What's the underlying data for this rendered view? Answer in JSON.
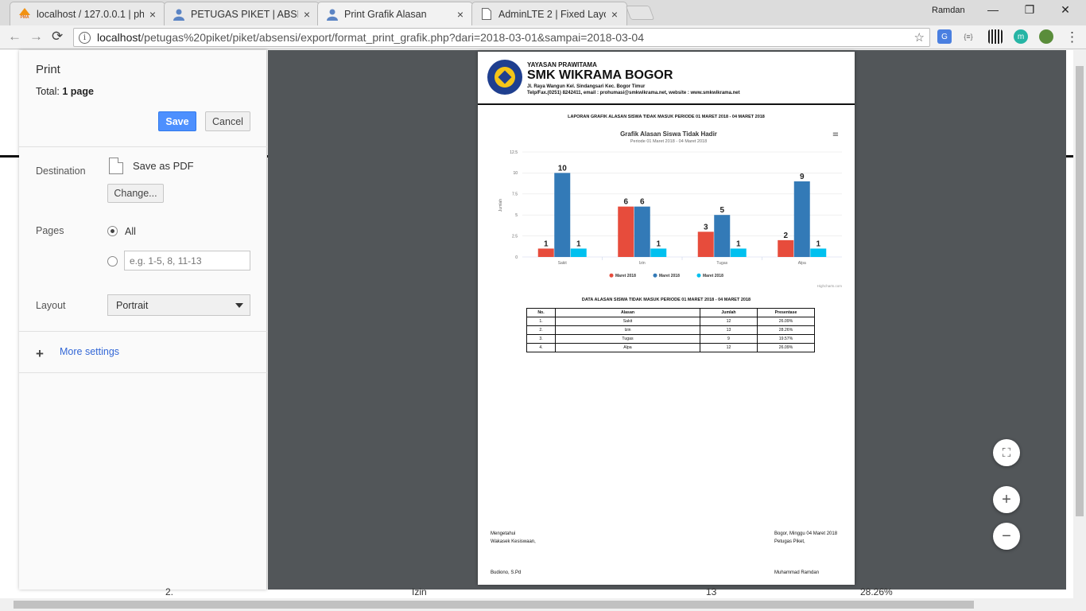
{
  "tabs": [
    {
      "title": "localhost / 127.0.0.1 | php",
      "favicon": "phpmyadmin-icon",
      "favicon_text": "PMA",
      "close": "×",
      "active": false
    },
    {
      "title": "PETUGAS PIKET | ABSENS",
      "favicon": "user-icon",
      "close": "×",
      "active": false
    },
    {
      "title": "Print Grafik Alasan",
      "favicon": "user-icon",
      "close": "×",
      "active": true
    },
    {
      "title": "AdminLTE 2 | Fixed Layou",
      "favicon": "page-icon",
      "close": "×",
      "active": false
    }
  ],
  "window": {
    "profile_name": "Ramdan",
    "minimize": "—",
    "restore": "❐",
    "close": "✕"
  },
  "address": {
    "host": "localhost",
    "path": "/petugas%20piket/piket/absensi/export/format_print_grafik.php?dari=2018-03-01&sampai=2018-03-04",
    "info_glyph": "i",
    "star_glyph": "☆"
  },
  "nav": {
    "back": "←",
    "forward": "→",
    "reload": "⟳",
    "menu": "⋮"
  },
  "extensions": {
    "json_viewer": "{≡}",
    "mercury": "m"
  },
  "print": {
    "title": "Print",
    "total_label": "Total:",
    "total_value": "1 page",
    "save_label": "Save",
    "cancel_label": "Cancel",
    "destination_label": "Destination",
    "destination_name": "Save as PDF",
    "change_label": "Change...",
    "pages_label": "Pages",
    "pages_all": "All",
    "pages_placeholder": "e.g. 1-5, 8, 11-13",
    "layout_label": "Layout",
    "layout_value": "Portrait",
    "more_settings_plus": "+",
    "more_settings": "More settings"
  },
  "zoom_controls": {
    "fit": "⛶",
    "zoom_in": "+",
    "zoom_out": "−"
  },
  "background_footer": {
    "col1": "2.",
    "col2": "Izin",
    "col3": "13",
    "col4": "28.26%"
  },
  "report": {
    "foundation": "YAYASAN PRAWITAMA",
    "school": "SMK WIKRAMA BOGOR",
    "address": "Jl. Raya Wangun Kel. Sindangsari Kec. Bogor Timur",
    "contact": "Telp/Fax.(0251) 8242411, email : prohumasi@smkwikrama.net, website : www.smkwikrama.net",
    "title": "LAPORAN GRAFIK ALASAN SISWA TIDAK MASUK PERIODE 01 MARET 2018 - 04 MARET 2018",
    "table_title": "DATA ALASAN SISWA TIDAK MASUK PERIODE 01 MARET 2018 - 04 MARET 2018",
    "table_headers": [
      "No.",
      "Alasan",
      "Jumlah",
      "Presentase"
    ],
    "table_rows": [
      [
        "1.",
        "Sakit",
        "12",
        "26.09%"
      ],
      [
        "2.",
        "Izin",
        "13",
        "28.26%"
      ],
      [
        "3.",
        "Tugas",
        "9",
        "19.57%"
      ],
      [
        "4.",
        "Alpa",
        "12",
        "26.09%"
      ]
    ],
    "sign_left_1": "Mengetahui",
    "sign_left_2": "Wakasek Kesiswaan,",
    "sign_left_name": "Budiono, S.Pd",
    "sign_right_1": "Bogor, Minggu 04 Maret 2018",
    "sign_right_2": "Petugas Piket,",
    "sign_right_name": "Muhammad Ramdan"
  },
  "chart_data": {
    "type": "bar",
    "title": "Grafik Alasan Siswa Tidak Hadir",
    "subtitle": "Periode 01 Maret 2018 - 04 Maret 2018",
    "xlabel": "",
    "ylabel": "Jumlah",
    "categories": [
      "Sakit",
      "Izin",
      "Tugas",
      "Alpa"
    ],
    "yticks": [
      "0",
      "2.5",
      "5",
      "7.5",
      "10",
      "12.5"
    ],
    "ylim": [
      0,
      12.5
    ],
    "series": [
      {
        "name": "Maret 2018",
        "color": "#e74c3c",
        "values": [
          1,
          6,
          3,
          2
        ]
      },
      {
        "name": "Maret 2018",
        "color": "#337ab7",
        "values": [
          10,
          6,
          5,
          9
        ]
      },
      {
        "name": "Maret 2018",
        "color": "#00c0ef",
        "values": [
          1,
          1,
          1,
          1
        ]
      }
    ],
    "grid": true,
    "legend": "bottom",
    "credits": "Highcharts.com",
    "menu_glyph": "≡"
  }
}
